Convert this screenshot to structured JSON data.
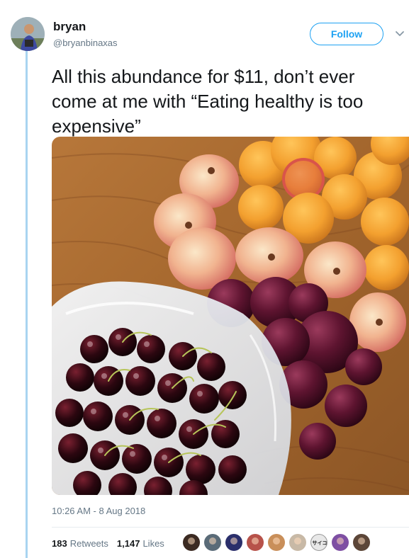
{
  "user": {
    "name": "bryan",
    "handle": "@bryanbinaxas",
    "avatar_icon": "user-avatar"
  },
  "header": {
    "follow_label": "Follow",
    "more_icon": "chevron-down-icon"
  },
  "tweet": {
    "text": "All this abundance for $11, don’t ever come at me with “Eating healthy is too expensive”",
    "timestamp": "10:26 AM - 8 Aug 2018"
  },
  "stats": {
    "retweets_count": "183",
    "retweets_label": "Retweets",
    "likes_count": "1,147",
    "likes_label": "Likes"
  },
  "likers": [
    {
      "name": "liker-avatar-1",
      "color": "#3b2a22"
    },
    {
      "name": "liker-avatar-2",
      "color": "#5a6b78"
    },
    {
      "name": "liker-avatar-3",
      "color": "#2b2f6b"
    },
    {
      "name": "liker-avatar-4",
      "color": "#b7524a"
    },
    {
      "name": "liker-avatar-5",
      "color": "#c98f5a"
    },
    {
      "name": "liker-avatar-6",
      "color": "#c8b9a6"
    },
    {
      "name": "liker-avatar-7",
      "color": "#e8e8e8",
      "text": "サイコ"
    },
    {
      "name": "liker-avatar-8",
      "color": "#7e4fa3"
    },
    {
      "name": "liker-avatar-9",
      "color": "#5c4638"
    }
  ],
  "colors": {
    "accent": "#1da1f2",
    "thread_line": "#a8d4f0",
    "secondary_text": "#657786",
    "primary_text": "#14171a"
  }
}
